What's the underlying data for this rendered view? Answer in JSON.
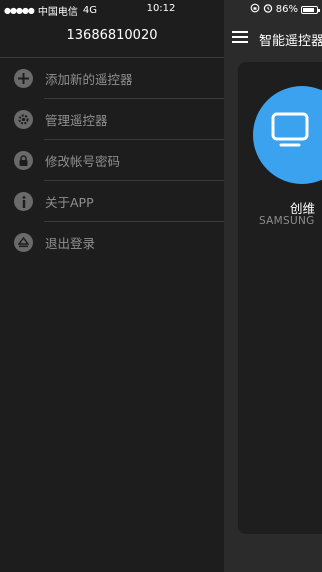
{
  "status_bar": {
    "signal_dots": "●●●●●",
    "carrier": "中国电信",
    "network": "4G",
    "time": "10:12",
    "battery_percent": "86%",
    "battery_level": 0.86,
    "icons": [
      "orientation-lock-icon",
      "alarm-icon",
      "battery-icon"
    ]
  },
  "drawer": {
    "account": "13686810020",
    "items": [
      {
        "label": "添加新的遥控器",
        "icon": "plus-icon"
      },
      {
        "label": "管理遥控器",
        "icon": "gear-icon"
      },
      {
        "label": "修改帐号密码",
        "icon": "lock-icon"
      },
      {
        "label": "关于APP",
        "icon": "info-icon"
      },
      {
        "label": "退出登录",
        "icon": "eject-icon"
      }
    ]
  },
  "main": {
    "title": "智能遥控器",
    "device": {
      "name": "创维",
      "brand": "SAMSUNG",
      "icon": "tv-icon",
      "accent": "#3aa2ef"
    }
  },
  "colors": {
    "drawer_bg": "#1d1d1d",
    "main_bg": "#2b2b2b",
    "accent": "#3aa2ef"
  }
}
